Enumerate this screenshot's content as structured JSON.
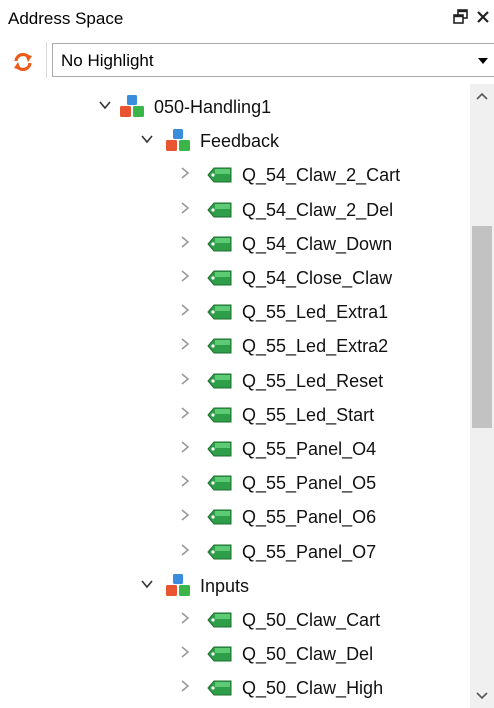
{
  "panel": {
    "title": "Address Space",
    "float_glyph": "🗗",
    "close_glyph": "✕"
  },
  "toolbar": {
    "highlight_value": "No Highlight"
  },
  "tree": [
    {
      "label": "050-Handling1",
      "level": 0,
      "kind": "object",
      "expanded": true
    },
    {
      "label": "Feedback",
      "level": 1,
      "kind": "object",
      "expanded": true
    },
    {
      "label": "Q_54_Claw_2_Cart",
      "level": 2,
      "kind": "tag",
      "expanded": false
    },
    {
      "label": "Q_54_Claw_2_Del",
      "level": 2,
      "kind": "tag",
      "expanded": false
    },
    {
      "label": "Q_54_Claw_Down",
      "level": 2,
      "kind": "tag",
      "expanded": false
    },
    {
      "label": "Q_54_Close_Claw",
      "level": 2,
      "kind": "tag",
      "expanded": false
    },
    {
      "label": "Q_55_Led_Extra1",
      "level": 2,
      "kind": "tag",
      "expanded": false
    },
    {
      "label": "Q_55_Led_Extra2",
      "level": 2,
      "kind": "tag",
      "expanded": false
    },
    {
      "label": "Q_55_Led_Reset",
      "level": 2,
      "kind": "tag",
      "expanded": false
    },
    {
      "label": "Q_55_Led_Start",
      "level": 2,
      "kind": "tag",
      "expanded": false
    },
    {
      "label": "Q_55_Panel_O4",
      "level": 2,
      "kind": "tag",
      "expanded": false
    },
    {
      "label": "Q_55_Panel_O5",
      "level": 2,
      "kind": "tag",
      "expanded": false
    },
    {
      "label": "Q_55_Panel_O6",
      "level": 2,
      "kind": "tag",
      "expanded": false
    },
    {
      "label": "Q_55_Panel_O7",
      "level": 2,
      "kind": "tag",
      "expanded": false
    },
    {
      "label": "Inputs",
      "level": 1,
      "kind": "object",
      "expanded": true
    },
    {
      "label": "Q_50_Claw_Cart",
      "level": 2,
      "kind": "tag",
      "expanded": false
    },
    {
      "label": "Q_50_Claw_Del",
      "level": 2,
      "kind": "tag",
      "expanded": false
    },
    {
      "label": "Q_50_Claw_High",
      "level": 2,
      "kind": "tag",
      "expanded": false
    }
  ],
  "scrollbar": {
    "position_fraction": 0.3
  }
}
